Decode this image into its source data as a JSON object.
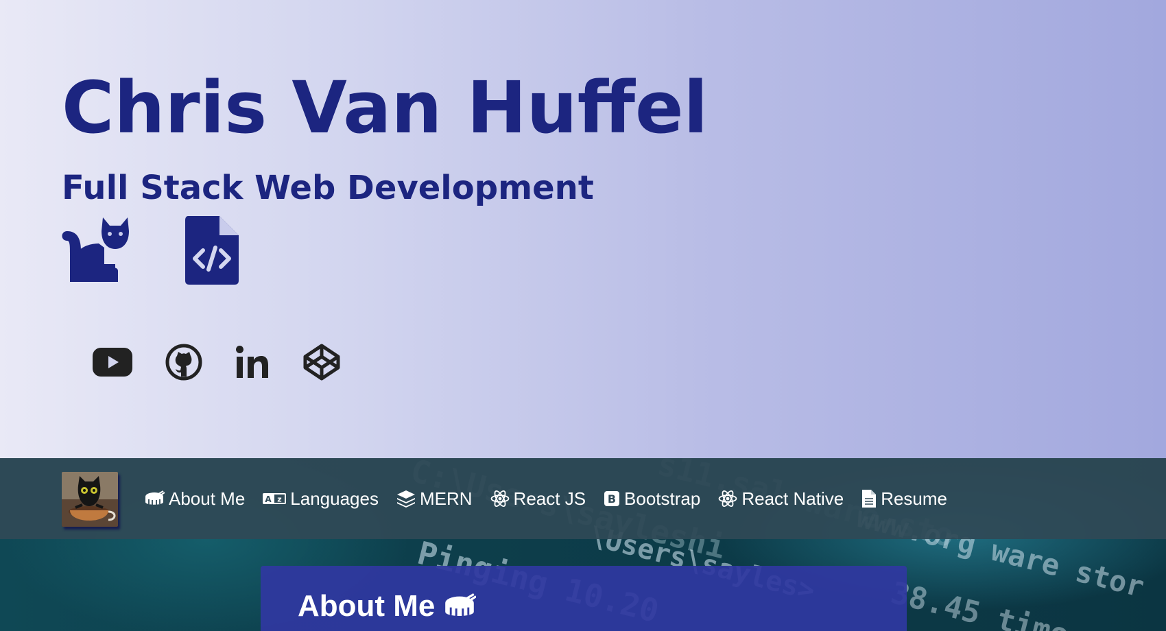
{
  "hero": {
    "title": "Chris Van Huffel",
    "subtitle": "Full Stack Web Development",
    "icons": [
      "cat-icon",
      "file-code-icon"
    ],
    "social": [
      "youtube-icon",
      "github-icon",
      "linkedin-icon",
      "codepen-icon"
    ]
  },
  "navbar": {
    "brand_icon": "cat-in-cup-avatar",
    "items": [
      {
        "icon": "drum-icon",
        "label": "About Me"
      },
      {
        "icon": "language-icon",
        "label": "Languages"
      },
      {
        "icon": "layers-icon",
        "label": "MERN"
      },
      {
        "icon": "react-icon",
        "label": "React JS"
      },
      {
        "icon": "bootstrap-icon",
        "label": "Bootstrap"
      },
      {
        "icon": "react-icon",
        "label": "React Native"
      },
      {
        "icon": "file-icon",
        "label": "Resume"
      }
    ]
  },
  "about": {
    "heading": "About Me",
    "heading_icon": "drum-icon"
  },
  "colors": {
    "primary": "#1c2580",
    "navbar": "#2f4956",
    "card": "#2f38a0",
    "social": "#222222"
  }
}
